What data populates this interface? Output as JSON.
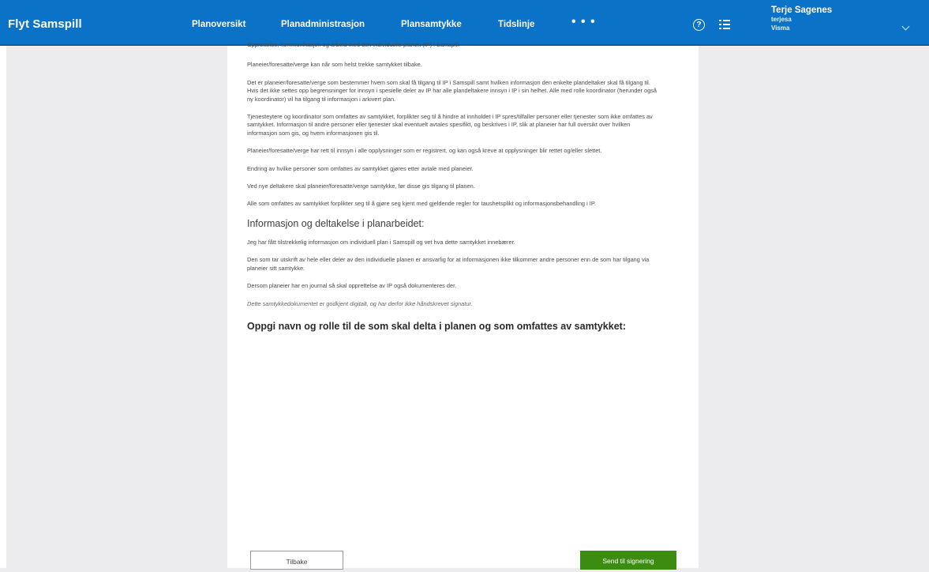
{
  "header": {
    "brand": "Flyt Samspill",
    "nav": [
      "Planoversikt",
      "Planadministrasjon",
      "Plansamtykke",
      "Tidslinje"
    ],
    "more": "• • •",
    "help_glyph": "?",
    "user": {
      "name": "Terje Sagenes",
      "username": "terjesa",
      "org": "Visma"
    },
    "icons": {
      "help": "help-circle-icon",
      "list": "list-icon",
      "chevron": "chevron-down-icon"
    }
  },
  "document": {
    "cut_line": "Opprettelse, kommunikasjon og arbeid med den individuelle planen (IP) i Samspill.",
    "paragraphs": [
      "Planeier/foresatte/verge kan når som helst trekke samtykket tilbake.",
      "Det er planeier/foresatte/verge som bestemmer hvem som skal få tilgang til IP i Samspill samt hvilken informasjon den enkelte plandeltaker skal få tilgang til. Hvis det ikke settes opp begrensninger for innsyn i spesielle deler av IP har alle plandeltakere innsyn i IP i sin helhet. Alle med rolle koordinator (herunder også ny koordinator) vil ha tilgang til informasjon i arkivert plan.",
      "Tjenesteytere og koordinator som omfattes av samtykket, forplikter seg til å hindre at innholdet i IP spres/tilfaller personer eller tjenester som ikke omfattes av samtykket. Informasjon til andre personer eller tjenester skal eventuelt avtales spesifikt, og beskrives i IP, slik at planeier har full oversikt over hvilken informasjon som gis, og hvem informasjonen gis til.",
      "Planeier/foresatte/verge har rett til innsyn i alle opplysninger som er registrert, og kan også kreve at opplysninger blir rettet og/eller slettet.",
      "Endring av hvilke personer som omfattes av samtykket gjøres etter avtale med planeier.",
      "Ved nye deltakere skal planeier/foresatte/verge samtykke, før disse gis tilgang til planen.",
      "Alle som omfattes av samtykket forplikter seg til å gjøre seg kjent med gjeldende regler for taushetsplikt og informasjonsbehandling i IP."
    ],
    "section_heading": "Informasjon og deltakelse i planarbeidet:",
    "section_paragraphs": [
      "Jeg har fått tilstrekkelig informasjon om individuell plan i Samspill og vet hva dette samtykket innebærer.",
      "Den som tar utskrift av hele eller deler av den individuelle planen er ansvarlig for at informasjonen ikke tilkommer andre personer enn de som har tilgang via planeier sitt samtykke.",
      "Dersom planeier har en journal så skal opprettelse av IP også dokumenteres der."
    ],
    "italic_note": "Dette samtykkedokumentet er godkjent digitalt, og har derfor ikke håndskrevet signatur.",
    "participants_heading": "Oppgi navn og rolle til de som skal delta i planen og som omfattes av samtykket:"
  },
  "actions": {
    "back": "Tilbake",
    "send": "Send til signering"
  },
  "colors": {
    "topbar": "#0a73c8",
    "background": "#ececee",
    "send_button": "#3d8c12"
  }
}
